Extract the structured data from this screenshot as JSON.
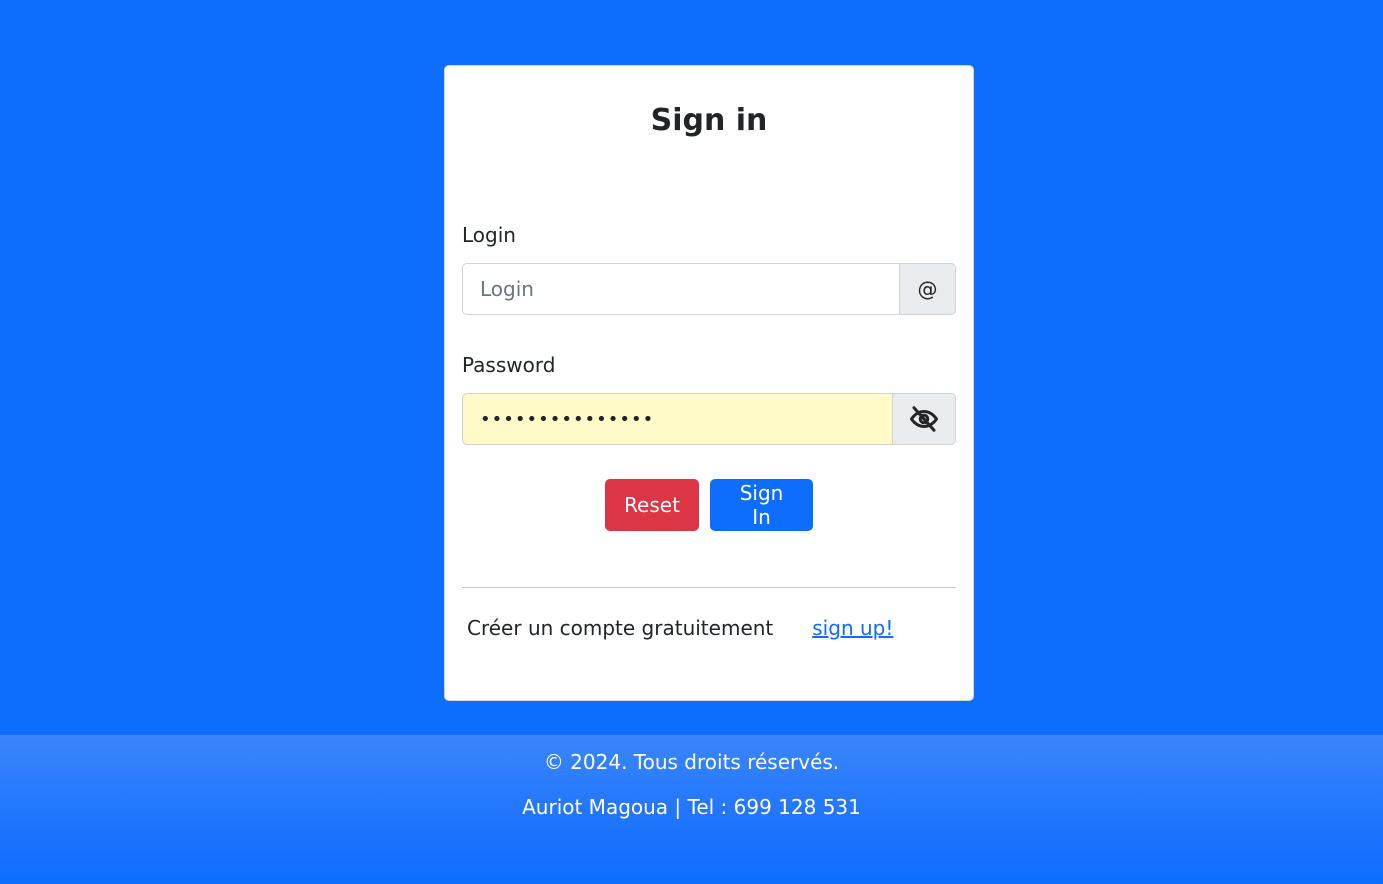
{
  "card": {
    "title": "Sign in"
  },
  "login": {
    "label": "Login",
    "placeholder": "Login",
    "value": "",
    "addon": "@"
  },
  "password": {
    "label": "Password",
    "value": "•••••••••••••••",
    "toggle_icon": "eye-slash-icon"
  },
  "buttons": {
    "reset": "Reset",
    "signin": "Sign In"
  },
  "signup": {
    "text": "Créer un compte gratuitement",
    "link": "sign up!"
  },
  "footer": {
    "copyright": "© 2024. Tous droits réservés.",
    "contact": "Auriot Magoua | Tel : 699 128 531"
  },
  "colors": {
    "background": "#0d6efd",
    "reset_button": "#dc3545",
    "signin_button": "#0d6efd",
    "autofill": "#fffac8"
  }
}
